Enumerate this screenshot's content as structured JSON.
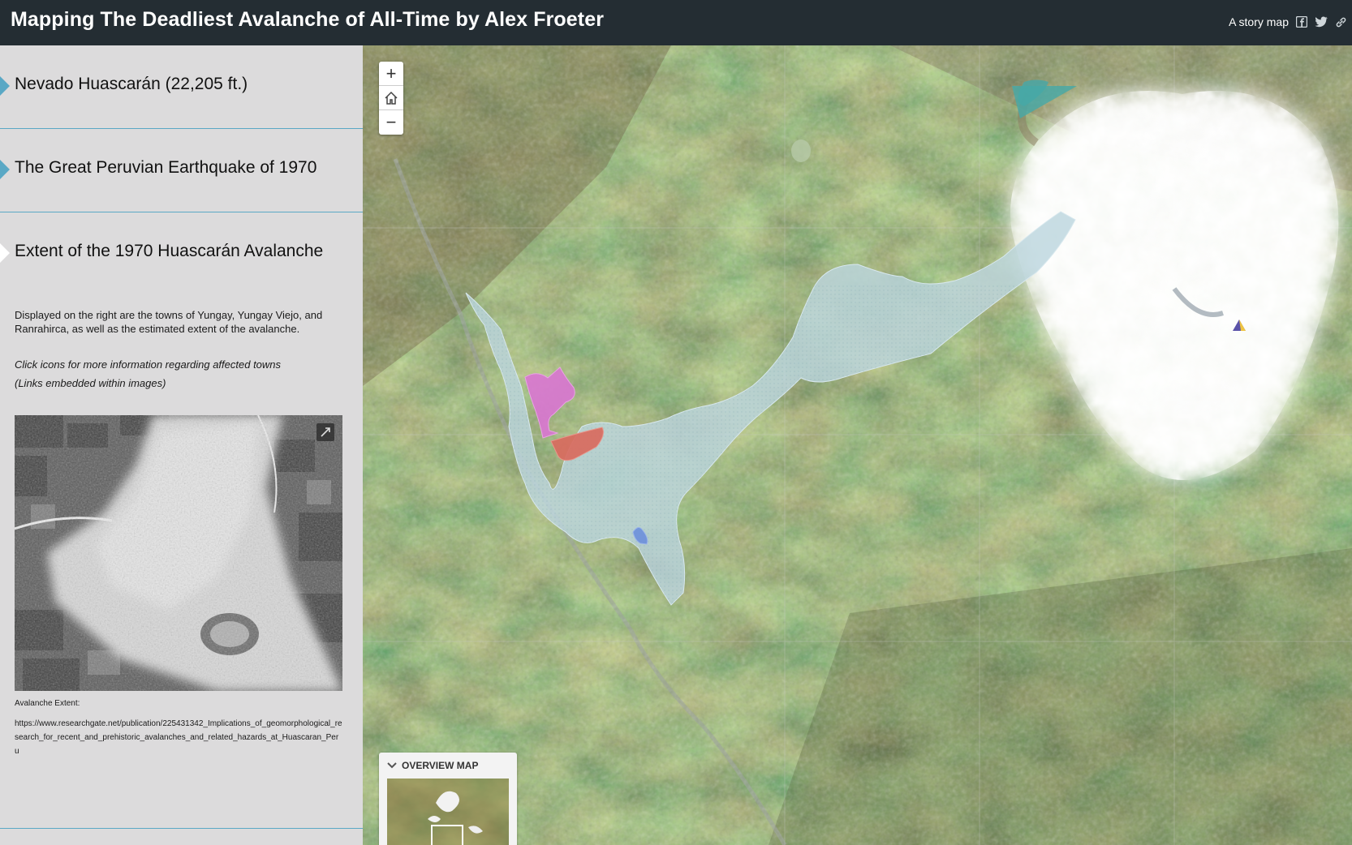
{
  "header": {
    "title": "Mapping The Deadliest Avalanche of All-Time by Alex Froeter",
    "tagline": "A story map",
    "icons": [
      "facebook-icon",
      "twitter-icon",
      "link-icon"
    ]
  },
  "sidebar": {
    "sections": [
      {
        "title": "Nevado Huascarán (22,205 ft.)"
      },
      {
        "title": "The Great Peruvian Earthquake of 1970"
      },
      {
        "title": "Extent of the 1970 Huascarán Avalanche"
      }
    ],
    "active": {
      "description": "Displayed on the right are the towns of Yungay, Yungay Viejo, and Ranrahirca, as well as the estimated extent of the avalanche.",
      "instruction": "Click icons for more information regarding affected towns",
      "note": "(Links embedded within images)",
      "caption_label": "Avalanche Extent:",
      "caption_url": "https://www.researchgate.net/publication/225431342_Implications_of_geomorphological_research_for_recent_and_prehistoric_avalanches_and_related_hazards_at_Huascaran_Peru"
    }
  },
  "map": {
    "zoom_in": "+",
    "zoom_out": "−",
    "overview_label": "OVERVIEW MAP",
    "colors": {
      "avalanche": "#b9d3da",
      "town_yungay": "#d977d0",
      "town_yungay_viejo": "#d8685e",
      "town_ranrahirca": "#6a8fd8"
    }
  }
}
